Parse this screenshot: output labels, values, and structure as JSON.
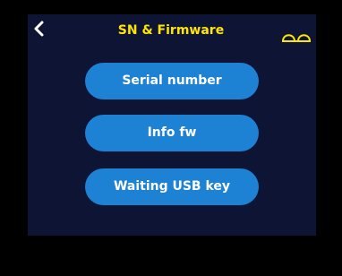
{
  "header": {
    "title": "SN & Firmware",
    "back_icon": "chevron-left-icon",
    "device_icon": "device-status-icon"
  },
  "menu": {
    "items": [
      {
        "label": "Serial number"
      },
      {
        "label": "Info fw"
      },
      {
        "label": "Waiting USB key"
      }
    ]
  },
  "colors": {
    "screen_background": "#0e1433",
    "outer_background": "#000000",
    "title": "#ffe600",
    "button": "#1d81d4",
    "button_text": "#ffffff"
  }
}
